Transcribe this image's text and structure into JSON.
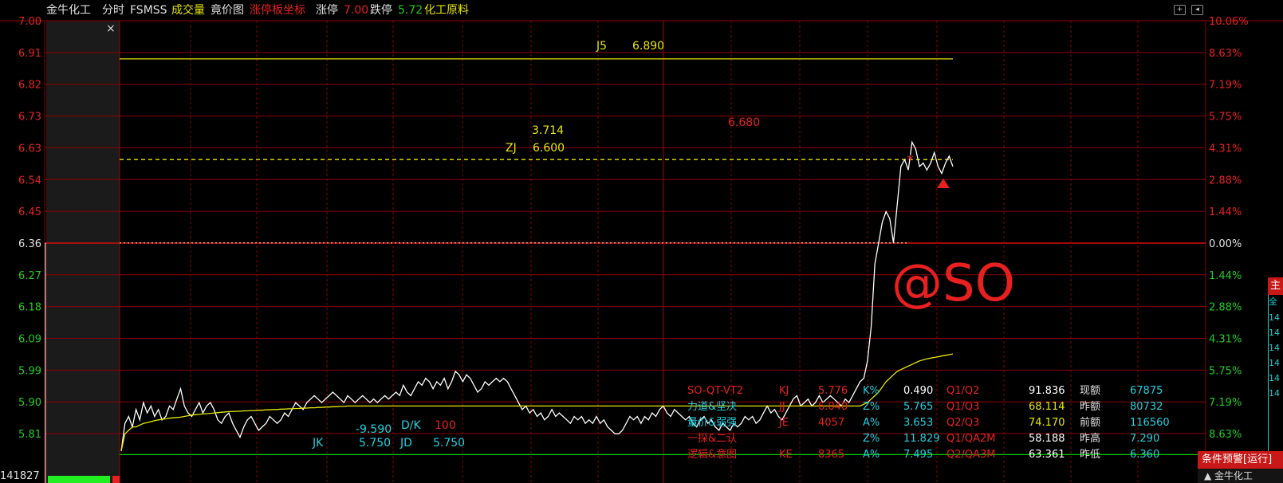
{
  "header": {
    "stock_name": "金牛化工",
    "tab_timeshare": "分时",
    "indicator": "FSMSS",
    "tab_volume": "成交量",
    "tab_auction": "竟价图",
    "tab_limit_axis": "涨停板坐标",
    "limit_up_label": "涨停",
    "limit_up_value": "7.00",
    "limit_down_label": "跌停",
    "limit_down_value": "5.72",
    "sector": "化工原料"
  },
  "left_panel": {
    "volume_readout": "141827"
  },
  "watermark": "@SO",
  "right_widgets": {
    "alert_tab": "条件预警[运行]",
    "alert_item": "金牛化工",
    "side_tab_1": "主",
    "side_tab_2": "全",
    "side_strip_values": [
      "14",
      "14",
      "14",
      "14",
      "14",
      "14"
    ]
  },
  "chart_data": {
    "type": "line",
    "title": "",
    "y_left_ticks": [
      "7.00",
      "6.91",
      "6.82",
      "6.73",
      "6.63",
      "6.54",
      "6.45",
      "6.36",
      "6.27",
      "6.18",
      "6.09",
      "5.99",
      "5.90",
      "5.81"
    ],
    "y_right_ticks": [
      "10.06%",
      "8.63%",
      "7.19%",
      "5.75%",
      "4.31%",
      "2.88%",
      "1.44%",
      "0.00%",
      "1.44%",
      "2.88%",
      "4.31%",
      "5.75%",
      "7.19%",
      "8.63%"
    ],
    "ylim": [
      5.72,
      7.0
    ],
    "prev_close": 6.36,
    "series": [
      {
        "name": "price",
        "color": "#ffffff",
        "values": [
          5.76,
          5.84,
          5.86,
          5.83,
          5.88,
          5.85,
          5.9,
          5.87,
          5.89,
          5.86,
          5.88,
          5.85,
          5.86,
          5.89,
          5.88,
          5.91,
          5.94,
          5.89,
          5.87,
          5.86,
          5.88,
          5.9,
          5.87,
          5.89,
          5.9,
          5.88,
          5.85,
          5.84,
          5.86,
          5.87,
          5.84,
          5.82,
          5.8,
          5.83,
          5.85,
          5.86,
          5.84,
          5.82,
          5.83,
          5.84,
          5.86,
          5.85,
          5.84,
          5.85,
          5.87,
          5.86,
          5.88,
          5.9,
          5.89,
          5.88,
          5.9,
          5.91,
          5.92,
          5.91,
          5.9,
          5.91,
          5.92,
          5.93,
          5.92,
          5.91,
          5.9,
          5.92,
          5.91,
          5.9,
          5.91,
          5.92,
          5.91,
          5.9,
          5.91,
          5.9,
          5.91,
          5.92,
          5.91,
          5.92,
          5.93,
          5.92,
          5.95,
          5.93,
          5.92,
          5.94,
          5.96,
          5.95,
          5.97,
          5.96,
          5.94,
          5.96,
          5.95,
          5.97,
          5.94,
          5.96,
          5.99,
          5.98,
          5.96,
          5.98,
          5.97,
          5.95,
          5.93,
          5.94,
          5.96,
          5.95,
          5.96,
          5.97,
          5.96,
          5.97,
          5.96,
          5.94,
          5.92,
          5.9,
          5.88,
          5.89,
          5.87,
          5.88,
          5.86,
          5.87,
          5.85,
          5.86,
          5.88,
          5.86,
          5.87,
          5.86,
          5.85,
          5.84,
          5.86,
          5.85,
          5.86,
          5.84,
          5.85,
          5.84,
          5.86,
          5.84,
          5.85,
          5.83,
          5.82,
          5.81,
          5.81,
          5.82,
          5.84,
          5.86,
          5.85,
          5.86,
          5.84,
          5.86,
          5.85,
          5.87,
          5.86,
          5.88,
          5.89,
          5.87,
          5.86,
          5.88,
          5.87,
          5.86,
          5.85,
          5.86,
          5.84,
          5.83,
          5.85,
          5.86,
          5.84,
          5.85,
          5.83,
          5.82,
          5.84,
          5.83,
          5.82,
          5.84,
          5.83,
          5.84,
          5.86,
          5.85,
          5.86,
          5.84,
          5.85,
          5.87,
          5.89,
          5.87,
          5.88,
          5.86,
          5.85,
          5.87,
          5.89,
          5.91,
          5.92,
          5.89,
          5.9,
          5.91,
          5.89,
          5.9,
          5.92,
          5.9,
          5.91,
          5.92,
          5.91,
          5.9,
          5.89,
          5.91,
          5.9,
          5.92,
          5.94,
          5.96,
          5.97,
          6.02,
          6.12,
          6.3,
          6.36,
          6.42,
          6.45,
          6.43,
          6.36,
          6.47,
          6.58,
          6.6,
          6.57,
          6.65,
          6.63,
          6.58,
          6.59,
          6.57,
          6.59,
          6.62,
          6.58,
          6.56,
          6.59,
          6.61,
          6.58
        ]
      },
      {
        "name": "avg",
        "color": "#e6e600",
        "values": [
          5.76,
          5.81,
          5.82,
          5.83,
          5.83,
          5.835,
          5.84,
          5.842,
          5.845,
          5.848,
          5.85,
          5.852,
          5.853,
          5.855,
          5.856,
          5.857,
          5.858,
          5.86,
          5.862,
          5.864,
          5.865,
          5.866,
          5.867,
          5.868,
          5.869,
          5.87,
          5.871,
          5.872,
          5.873,
          5.874,
          5.874,
          5.875,
          5.875,
          5.876,
          5.876,
          5.877,
          5.877,
          5.878,
          5.878,
          5.879,
          5.879,
          5.88,
          5.88,
          5.881,
          5.881,
          5.882,
          5.882,
          5.883,
          5.883,
          5.884,
          5.884,
          5.885,
          5.885,
          5.886,
          5.886,
          5.887,
          5.887,
          5.888,
          5.888,
          5.889,
          5.889,
          5.89,
          5.89,
          5.89,
          5.89,
          5.89,
          5.89,
          5.89,
          5.89,
          5.89,
          5.89,
          5.89,
          5.89,
          5.89,
          5.89,
          5.89,
          5.89,
          5.89,
          5.89,
          5.89,
          5.89,
          5.89,
          5.89,
          5.89,
          5.89,
          5.89,
          5.89,
          5.89,
          5.89,
          5.89,
          5.89,
          5.89,
          5.89,
          5.89,
          5.89,
          5.89,
          5.89,
          5.89,
          5.89,
          5.89,
          5.89,
          5.89,
          5.89,
          5.89,
          5.89,
          5.89,
          5.89,
          5.89,
          5.89,
          5.89,
          5.89,
          5.89,
          5.89,
          5.89,
          5.89,
          5.89,
          5.89,
          5.89,
          5.89,
          5.89,
          5.89,
          5.89,
          5.89,
          5.89,
          5.89,
          5.89,
          5.89,
          5.89,
          5.89,
          5.89,
          5.89,
          5.89,
          5.89,
          5.89,
          5.89,
          5.89,
          5.89,
          5.89,
          5.89,
          5.89,
          5.89,
          5.89,
          5.89,
          5.89,
          5.89,
          5.89,
          5.89,
          5.89,
          5.89,
          5.89,
          5.89,
          5.89,
          5.89,
          5.89,
          5.89,
          5.89,
          5.89,
          5.89,
          5.89,
          5.89,
          5.89,
          5.89,
          5.89,
          5.89,
          5.89,
          5.89,
          5.89,
          5.89,
          5.89,
          5.89,
          5.89,
          5.89,
          5.89,
          5.89,
          5.89,
          5.89,
          5.89,
          5.89,
          5.89,
          5.89,
          5.89,
          5.89,
          5.89,
          5.89,
          5.89,
          5.89,
          5.89,
          5.89,
          5.89,
          5.89,
          5.89,
          5.89,
          5.89,
          5.89,
          5.89,
          5.89,
          5.89,
          5.89,
          5.89,
          5.89,
          5.895,
          5.9,
          5.91,
          5.92,
          5.93,
          5.945,
          5.96,
          5.97,
          5.98,
          5.99,
          5.995,
          6.0,
          6.005,
          6.01,
          6.015,
          6.02,
          6.023,
          6.026,
          6.028,
          6.03,
          6.032,
          6.034,
          6.036,
          6.038,
          6.04
        ]
      }
    ],
    "annotations": [
      {
        "text": "J5",
        "color": "#e6e600"
      },
      {
        "text": "6.890",
        "color": "#e6e600"
      },
      {
        "text": "3.714",
        "color": "#e6e600"
      },
      {
        "text": "ZJ",
        "color": "#e6e600"
      },
      {
        "text": "6.600",
        "color": "#e6e600"
      },
      {
        "text": "6.680",
        "color": "#e82020"
      },
      {
        "text": "-9.590",
        "color": "#22d0e0"
      },
      {
        "text": "D/K",
        "color": "#22d0e0"
      },
      {
        "text": "100",
        "color": "#e82020"
      },
      {
        "text": "JK",
        "color": "#22d0e0"
      },
      {
        "text": "5.750",
        "color": "#22d0e0"
      },
      {
        "text": "JD",
        "color": "#22d0e0"
      },
      {
        "text": "5.750",
        "color": "#22d0e0"
      }
    ],
    "reference_lines": [
      {
        "label": "J5",
        "value": 6.89,
        "color": "#e6e600",
        "style": "solid"
      },
      {
        "label": "ZJ",
        "value": 6.6,
        "color": "#e6e600",
        "style": "dashed"
      },
      {
        "label": "prev_close",
        "value": 6.36,
        "color": "#cccccc",
        "style": "dotted"
      },
      {
        "label": "JK",
        "value": 5.75,
        "color": "#00cc00",
        "style": "solid"
      }
    ],
    "grid": true,
    "stats_table": [
      {
        "c1": "SO-QT-VT2",
        "c2": "KJ",
        "c3": "5.776",
        "c4": "K%",
        "c5": "0.490",
        "c6": "Q1/Q2",
        "c7": "91.836",
        "c8": "现额",
        "c9": "67875"
      },
      {
        "c1": "力道&坚决",
        "c2": "JJ",
        "c3": "6.040",
        "c4": "Z%",
        "c5": "5.765",
        "c6": "Q1/Q3",
        "c7": "68.114",
        "c8": "昨额",
        "c9": "80732"
      },
      {
        "c1": "量价&弱强",
        "c2": "JE",
        "c3": "4057",
        "c4": "A%",
        "c5": "3.653",
        "c6": "Q2/Q3",
        "c7": "74.170",
        "c8": "前额",
        "c9": "116560"
      },
      {
        "c1": "一探&二认",
        "c2": "",
        "c3": "",
        "c4": "Z%",
        "c5": "11.829",
        "c6": "Q1/QA2M",
        "c7": "58.188",
        "c8": "昨高",
        "c9": "7.290"
      },
      {
        "c1": "逻辑&意图",
        "c2": "KE",
        "c3": "8365",
        "c4": "A%",
        "c5": "7.495",
        "c6": "Q2/QA3M",
        "c7": "63.361",
        "c8": "昨低",
        "c9": "6.360"
      }
    ],
    "colors": {
      "up": "#e82020",
      "grid": "#8c0000",
      "price": "#ffffff",
      "avg": "#e6e600"
    }
  }
}
